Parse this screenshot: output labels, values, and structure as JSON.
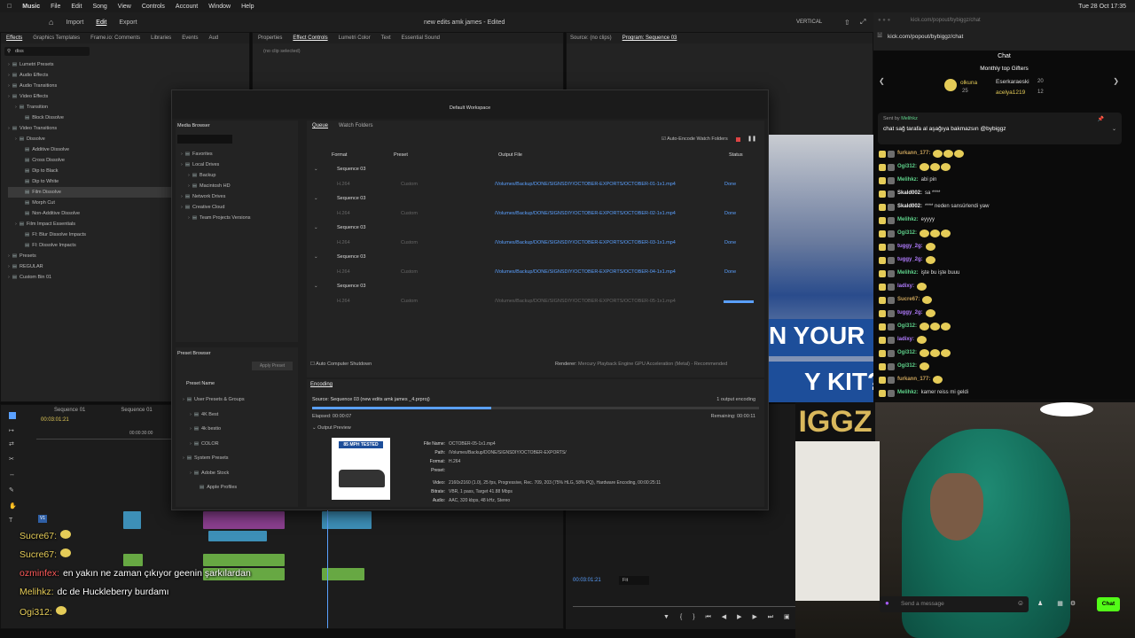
{
  "menubar": {
    "apple": "",
    "app": "Music",
    "items": [
      "File",
      "Edit",
      "Song",
      "View",
      "Controls",
      "Account",
      "Window",
      "Help"
    ],
    "clock": "Tue 28 Oct  17:35"
  },
  "premiere": {
    "nav": [
      "Import",
      "Edit",
      "Export"
    ],
    "title": "new edits amk james - Edited",
    "vertical_label": "VERTICAL",
    "effects_tabs": [
      "Effects",
      "Graphics Templates",
      "Frame.io: Comments",
      "Libraries",
      "Events",
      "Aud"
    ],
    "effects_search": "diss",
    "effects_tree": [
      {
        "label": "Lumetri Presets",
        "d": 0
      },
      {
        "label": "Audio Effects",
        "d": 0
      },
      {
        "label": "Audio Transitions",
        "d": 0
      },
      {
        "label": "Video Effects",
        "d": 0
      },
      {
        "label": "Transition",
        "d": 1
      },
      {
        "label": "Block Dissolve",
        "d": 2
      },
      {
        "label": "Video Transitions",
        "d": 0
      },
      {
        "label": "Dissolve",
        "d": 1
      },
      {
        "label": "Additive Dissolve",
        "d": 2
      },
      {
        "label": "Cross Dissolve",
        "d": 2
      },
      {
        "label": "Dip to Black",
        "d": 2
      },
      {
        "label": "Dip to White",
        "d": 2
      },
      {
        "label": "Film Dissolve",
        "d": 2
      },
      {
        "label": "Morph Cut",
        "d": 2
      },
      {
        "label": "Non-Additive Dissolve",
        "d": 2
      },
      {
        "label": "Film Impact Essentials",
        "d": 1
      },
      {
        "label": "FI: Blur Dissolve Impacts",
        "d": 2
      },
      {
        "label": "FI: Dissolve Impacts",
        "d": 2
      },
      {
        "label": "Presets",
        "d": 0
      },
      {
        "label": "REGULAR",
        "d": 0
      },
      {
        "label": "Custom Bin 01",
        "d": 0
      }
    ],
    "props_tabs": [
      "Properties",
      "Effect Controls",
      "Lumetri Color",
      "Text",
      "Essential Sound"
    ],
    "no_clip": "(no clip selected)",
    "source_tab": "Source: (no clips)",
    "program_tab": "Program: Sequence 03",
    "program_timecode": "00:03:01:21",
    "fit": "Fit",
    "timeline_tabs": [
      "Sequence 01",
      "Sequence 01"
    ],
    "timeline_timecode": "00:03:01:21",
    "ruler_time": "00:00:30:00",
    "track_label": "V1"
  },
  "media_encoder": {
    "workspace": "Default Workspace",
    "media_browser": "Media Browser",
    "browser_tree": [
      {
        "label": "Favorites",
        "d": 0
      },
      {
        "label": "Local Drives",
        "d": 0
      },
      {
        "label": "Backup",
        "d": 1
      },
      {
        "label": "Macintosh HD",
        "d": 1
      },
      {
        "label": "Network Drives",
        "d": 0
      },
      {
        "label": "Creative Cloud",
        "d": 0
      },
      {
        "label": "Team Projects Versions",
        "d": 1
      }
    ],
    "preset_browser": "Preset Browser",
    "apply_preset": "Apply Preset",
    "preset_name": "Preset Name",
    "preset_tree": [
      {
        "label": "User Presets & Groups",
        "d": 0
      },
      {
        "label": "4K Best",
        "d": 1
      },
      {
        "label": "4k bestio",
        "d": 1
      },
      {
        "label": "COLOR",
        "d": 1
      },
      {
        "label": "System Presets",
        "d": 0
      },
      {
        "label": "Adobe Stock",
        "d": 1
      },
      {
        "label": "Apple Profiles",
        "d": 2
      }
    ],
    "queue_tabs": [
      "Queue",
      "Watch Folders"
    ],
    "auto_encode": "Auto-Encode Watch Folders",
    "columns": [
      "Format",
      "Preset",
      "Output File",
      "Status"
    ],
    "queue": [
      {
        "seq": "Sequence 03",
        "format": "H.264",
        "preset": "Custom",
        "out": "/Volumes/Backup/DONE/SIGNSDIY/OCTOBER-EXPORTS/OCTOBER-01-1x1.mp4",
        "status": "Done"
      },
      {
        "seq": "Sequence 03",
        "format": "H.264",
        "preset": "Custom",
        "out": "/Volumes/Backup/DONE/SIGNSDIY/OCTOBER-EXPORTS/OCTOBER-02-1x1.mp4",
        "status": "Done"
      },
      {
        "seq": "Sequence 03",
        "format": "H.264",
        "preset": "Custom",
        "out": "/Volumes/Backup/DONE/SIGNSDIY/OCTOBER-EXPORTS/OCTOBER-03-1x1.mp4",
        "status": "Done"
      },
      {
        "seq": "Sequence 03",
        "format": "H.264",
        "preset": "Custom",
        "out": "/Volumes/Backup/DONE/SIGNSDIY/OCTOBER-EXPORTS/OCTOBER-04-1x1.mp4",
        "status": "Done"
      },
      {
        "seq": "Sequence 03",
        "format": "H.264",
        "preset": "Custom",
        "out": "/Volumes/Backup/DONE/SIGNSDIY/OCTOBER-EXPORTS/OCTOBER-05-1x1.mp4",
        "status": ""
      }
    ],
    "auto_shutdown": "Auto Computer Shutdown",
    "renderer_label": "Renderer:",
    "renderer_value": "Mercury Playback Engine GPU Acceleration (Metal) - Recommended",
    "encoding_tab": "Encoding",
    "source": "Source: Sequence 03 (new edits amk james _4.prproj)",
    "output_count": "1 output encoding",
    "elapsed": "Elapsed: 00:00:07",
    "remaining": "Remaining: 00:00:11",
    "progress": 0.4,
    "output_preview": "Output Preview",
    "thumb_text": "85 MPH TESTED",
    "info": [
      {
        "k": "File Name:",
        "v": "OCTOBER-05-1x1.mp4"
      },
      {
        "k": "Path:",
        "v": "/Volumes/Backup/DONE/SIGNSDIY/OCTOBER-EXPORTS/"
      },
      {
        "k": "Format:",
        "v": "H.264"
      },
      {
        "k": "Preset:",
        "v": ""
      },
      {
        "k": "Video:",
        "v": "2160x2160 (1.0), 25 fps, Progressive, Rec. 709, 203 (75% HLG, 58% PQ), Hardware Encoding, 00:00:25:11"
      },
      {
        "k": "Bitrate:",
        "v": "VBR, 1 pass, Target 41.88 Mbps"
      },
      {
        "k": "Audio:",
        "v": "AAC, 320 kbps, 48 kHz, Stereo"
      }
    ]
  },
  "browser": {
    "url": "kick.com/popout/bybiggz/chat",
    "url2": "kick.com/popout/bybiggz/chat"
  },
  "chat": {
    "title": "Chat",
    "gifters_title": "Monthly top Gifters",
    "gifters": [
      {
        "name": "olkuna",
        "count": "25"
      },
      {
        "name": "Eserkaraeski",
        "count": "20"
      },
      {
        "name": "acelya1219",
        "count": "12"
      }
    ],
    "pinned_by": "Sent by",
    "pinned_user": "Melihkz",
    "pinned_msg": "chat sağ tarafa al aşağıya bakmazsın @bybiggz",
    "messages": [
      {
        "user": "furkann_177:",
        "text": "",
        "color": "#c9a25a"
      },
      {
        "user": "Ogi312:",
        "text": "",
        "color": "#5fd38b"
      },
      {
        "user": "Melihkz:",
        "text": "abi pin",
        "color": "#5fd38b"
      },
      {
        "user": "Skald002:",
        "text": "sa ****",
        "color": "#eee"
      },
      {
        "user": "Skald002:",
        "text": "**** neden sansürlendi yaw",
        "color": "#eee"
      },
      {
        "user": "Melihkz:",
        "text": "eyyyy",
        "color": "#5fd38b"
      },
      {
        "user": "Ogi312:",
        "text": "",
        "color": "#5fd38b"
      },
      {
        "user": "tuggy_2g:",
        "text": "",
        "color": "#b27cff"
      },
      {
        "user": "tuggy_2g:",
        "text": "",
        "color": "#b27cff"
      },
      {
        "user": "Melihkz:",
        "text": "işte bu işte buuu",
        "color": "#5fd38b"
      },
      {
        "user": "ladixy:",
        "text": "",
        "color": "#b27cff"
      },
      {
        "user": "Sucre67:",
        "text": "",
        "color": "#c9a25a"
      },
      {
        "user": "tuggy_2g:",
        "text": "",
        "color": "#b27cff"
      },
      {
        "user": "Ogi312:",
        "text": "",
        "color": "#5fd38b"
      },
      {
        "user": "ladixy:",
        "text": "",
        "color": "#b27cff"
      },
      {
        "user": "Ogi312:",
        "text": "",
        "color": "#5fd38b"
      },
      {
        "user": "Ogi312:",
        "text": "",
        "color": "#5fd38b"
      },
      {
        "user": "furkann_177:",
        "text": "",
        "color": "#c9a25a"
      },
      {
        "user": "Melihkz:",
        "text": "kamer reiss mi geldi",
        "color": "#5fd38b"
      }
    ],
    "placeholder": "Send a message",
    "send": "Chat"
  },
  "video": {
    "banner": "N YOUR",
    "banner2": "Y KIT?",
    "logo": "IGGZ"
  },
  "overlay": [
    {
      "user": "Sucre67:",
      "text": "",
      "ucolor": "#e5cc58"
    },
    {
      "user": "Sucre67:",
      "text": "",
      "ucolor": "#e5cc58"
    },
    {
      "user": "ozminfex:",
      "text": "en yakın ne zaman çıkıyor geenin şarkılardan",
      "ucolor": "#ff5a5a"
    },
    {
      "user": "Melihkz:",
      "text": "dc de Huckleberry burdamı",
      "ucolor": "#e5cc58"
    },
    {
      "user": "Ogi312:",
      "text": "",
      "ucolor": "#e5cc58"
    }
  ],
  "colors": {
    "kick_green": "#53fc18",
    "premiere_blue": "#5aa0ff"
  }
}
